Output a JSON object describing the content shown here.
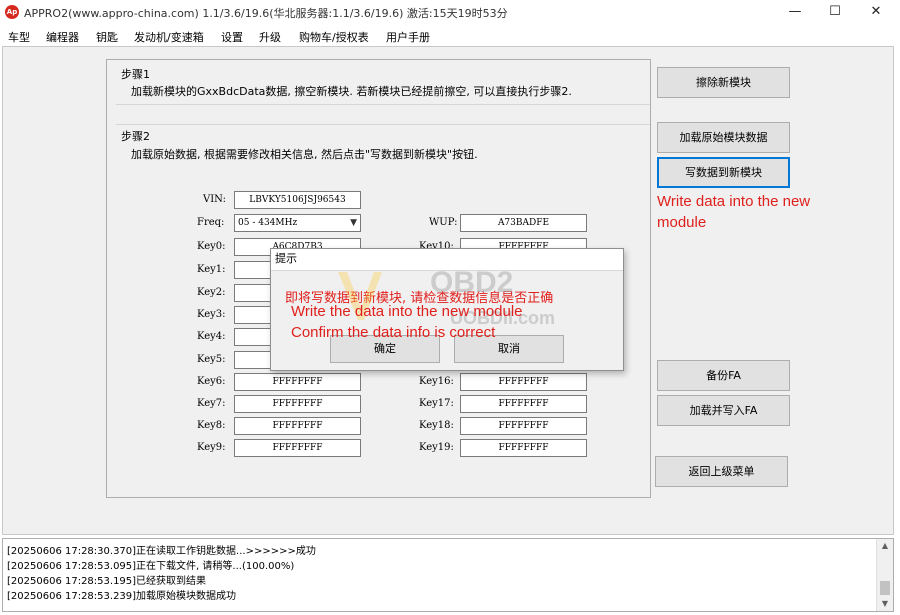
{
  "window": {
    "icon_text": "Ap",
    "title": "APPRO2(www.appro-china.com)  1.1/3.6/19.6(华北服务器:1.1/3.6/19.6)  激活:15天19时53分",
    "minimize_glyph": "—",
    "maximize_glyph": "☐",
    "close_glyph": "✕"
  },
  "menu": [
    "车型",
    "编程器",
    "钥匙",
    "发动机/变速箱",
    "设置",
    "升级",
    "购物车/授权表",
    "用户手册"
  ],
  "step1": {
    "title": "步骤1",
    "desc": "加载新模块的GxxBdcData数据, 擦空新模块. 若新模块已经提前擦空, 可以直接执行步骤2."
  },
  "step2": {
    "title": "步骤2",
    "desc": "加载原始数据, 根据需要修改相关信息, 然后点击\"写数据到新模块\"按钮."
  },
  "fields": {
    "vin_label": "VIN:",
    "vin_value": "LBVKY5106JSJ96543",
    "freq_label": "Freq:",
    "freq_value": "05 - 434MHz",
    "wup_label": "WUP:",
    "wup_value": "A73BADFE"
  },
  "keys_left": [
    {
      "label": "Key0:",
      "value": "A6C8D7B3"
    },
    {
      "label": "Key1:",
      "value": ""
    },
    {
      "label": "Key2:",
      "value": ""
    },
    {
      "label": "Key3:",
      "value": ""
    },
    {
      "label": "Key4:",
      "value": ""
    },
    {
      "label": "Key5:",
      "value": ""
    },
    {
      "label": "Key6:",
      "value": "FFFFFFFF"
    },
    {
      "label": "Key7:",
      "value": "FFFFFFFF"
    },
    {
      "label": "Key8:",
      "value": "FFFFFFFF"
    },
    {
      "label": "Key9:",
      "value": "FFFFFFFF"
    }
  ],
  "keys_right": [
    {
      "label": "Key10:",
      "value": "FFFFFFFF"
    },
    {
      "label": "Key16:",
      "value": "FFFFFFFF"
    },
    {
      "label": "Key17:",
      "value": "FFFFFFFF"
    },
    {
      "label": "Key18:",
      "value": "FFFFFFFF"
    },
    {
      "label": "Key19:",
      "value": "FFFFFFFF"
    }
  ],
  "buttons": {
    "erase": "擦除新模块",
    "load_original": "加载原始模块数据",
    "write_new": "写数据到新模块",
    "backup_fa": "备份FA",
    "load_write_fa": "加载并写入FA",
    "back_menu": "返回上级菜单"
  },
  "annotation": {
    "line1": "Write data into the new",
    "line2": "module"
  },
  "dialog": {
    "title": "提示",
    "message": "即将写数据到新模块, 请检查数据信息是否正确",
    "ok": "确定",
    "cancel": "取消",
    "annot1": "Write the data into the new module",
    "annot2": "Confirm the data info is correct"
  },
  "watermark": {
    "brand": "OBD2",
    "site": "UOBDII.com"
  },
  "log": [
    "[20250606 17:28:30.370]正在读取工作钥匙数据...>>>>>>成功",
    "[20250606 17:28:53.095]正在下载文件, 请稍等...(100.00%)",
    "[20250606 17:28:53.195]已经获取到结果",
    "[20250606 17:28:53.239]加载原始模块数据成功"
  ],
  "colors": {
    "annotation_red": "#e0201c",
    "focus_blue": "#0078d7",
    "app_icon_red": "#d42a20"
  }
}
